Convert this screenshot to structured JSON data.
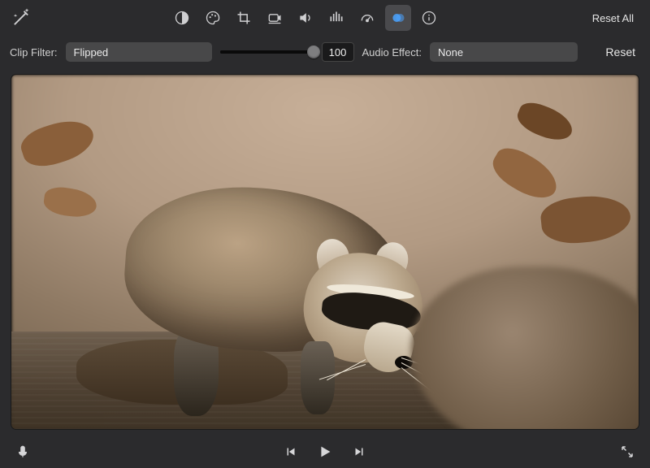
{
  "toolbar": {
    "reset_all": "Reset All",
    "icons": [
      "magic-wand",
      "contrast",
      "palette",
      "crop",
      "camera",
      "volume",
      "levels",
      "speedometer",
      "layers",
      "info"
    ],
    "active_index": 8
  },
  "controls": {
    "clip_filter_label": "Clip Filter:",
    "clip_filter_value": "Flipped",
    "filter_amount": 100,
    "filter_amount_percent": 100,
    "audio_effect_label": "Audio Effect:",
    "audio_effect_value": "None",
    "reset_label": "Reset"
  },
  "preview": {
    "description": "raccoon standing in shallow water on rocks with blurred leaf litter background"
  },
  "transport": {
    "mic_icon": "microphone-icon",
    "prev_icon": "skip-back-icon",
    "play_icon": "play-icon",
    "next_icon": "skip-forward-icon",
    "fullscreen_icon": "fullscreen-icon"
  }
}
